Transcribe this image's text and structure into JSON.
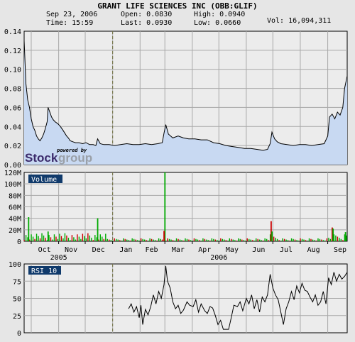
{
  "header": {
    "title": "GRANT LIFE SCIENCES INC (OBB:GLIF)",
    "date": "Sep 23, 2006",
    "time": "Time: 15:59",
    "open": "Open: 0.0830",
    "last": "Last: 0.0930",
    "high": "High: 0.0940",
    "low": "Low: 0.0660",
    "vol": "Vol: 16,094,311"
  },
  "logo": {
    "powered_by": "powered by",
    "brand_a": "Stock",
    "brand_b": "group"
  },
  "colors": {
    "background": "#e6e6e6",
    "price_fill": "#c8d9f2",
    "price_line": "#000000",
    "grid": "#a8a8a8",
    "vol_up": "#00aa00",
    "vol_down": "#cc0000",
    "panel_label_bg": "#103a6b",
    "panel_label_text": "#ffffff"
  },
  "chart_data": [
    {
      "type": "area",
      "title": "GRANT LIFE SCIENCES INC (OBB:GLIF)",
      "ylabel": "",
      "ylim": [
        0,
        0.14
      ],
      "yticks": [
        "0.14",
        "0.12",
        "0.10",
        "0.08",
        "0.06",
        "0.04",
        "0.02",
        "0.00"
      ],
      "grid": true,
      "x_start": "2005-09-23",
      "x_end": "2006-09-23",
      "price_points": [
        [
          "2005-09-23",
          0.13
        ],
        [
          "2005-09-25",
          0.085
        ],
        [
          "2005-09-27",
          0.068
        ],
        [
          "2005-09-29",
          0.06
        ],
        [
          "2005-10-01",
          0.048
        ],
        [
          "2005-10-03",
          0.04
        ],
        [
          "2005-10-05",
          0.036
        ],
        [
          "2005-10-07",
          0.03
        ],
        [
          "2005-10-09",
          0.027
        ],
        [
          "2005-10-11",
          0.025
        ],
        [
          "2005-10-13",
          0.028
        ],
        [
          "2005-10-15",
          0.032
        ],
        [
          "2005-10-17",
          0.038
        ],
        [
          "2005-10-19",
          0.045
        ],
        [
          "2005-10-20",
          0.06
        ],
        [
          "2005-10-22",
          0.055
        ],
        [
          "2005-10-24",
          0.05
        ],
        [
          "2005-10-26",
          0.047
        ],
        [
          "2005-10-28",
          0.045
        ],
        [
          "2005-10-31",
          0.043
        ],
        [
          "2005-11-03",
          0.04
        ],
        [
          "2005-11-06",
          0.036
        ],
        [
          "2005-11-08",
          0.033
        ],
        [
          "2005-11-10",
          0.03
        ],
        [
          "2005-11-12",
          0.028
        ],
        [
          "2005-11-14",
          0.025
        ],
        [
          "2005-11-17",
          0.024
        ],
        [
          "2005-11-20",
          0.023
        ],
        [
          "2005-11-24",
          0.023
        ],
        [
          "2005-11-28",
          0.022
        ],
        [
          "2005-12-02",
          0.023
        ],
        [
          "2005-12-06",
          0.021
        ],
        [
          "2005-12-10",
          0.021
        ],
        [
          "2005-12-13",
          0.02
        ],
        [
          "2005-12-15",
          0.027
        ],
        [
          "2005-12-18",
          0.022
        ],
        [
          "2005-12-22",
          0.021
        ],
        [
          "2005-12-28",
          0.021
        ],
        [
          "2006-01-03",
          0.02
        ],
        [
          "2006-01-10",
          0.021
        ],
        [
          "2006-01-17",
          0.022
        ],
        [
          "2006-01-24",
          0.021
        ],
        [
          "2006-01-31",
          0.021
        ],
        [
          "2006-02-07",
          0.022
        ],
        [
          "2006-02-14",
          0.021
        ],
        [
          "2006-02-21",
          0.022
        ],
        [
          "2006-02-26",
          0.023
        ],
        [
          "2006-02-28",
          0.033
        ],
        [
          "2006-03-02",
          0.042
        ],
        [
          "2006-03-05",
          0.032
        ],
        [
          "2006-03-10",
          0.028
        ],
        [
          "2006-03-16",
          0.03
        ],
        [
          "2006-03-22",
          0.028
        ],
        [
          "2006-03-28",
          0.027
        ],
        [
          "2006-04-04",
          0.027
        ],
        [
          "2006-04-11",
          0.026
        ],
        [
          "2006-04-18",
          0.026
        ],
        [
          "2006-04-25",
          0.023
        ],
        [
          "2006-05-02",
          0.022
        ],
        [
          "2006-05-09",
          0.02
        ],
        [
          "2006-05-16",
          0.019
        ],
        [
          "2006-05-23",
          0.018
        ],
        [
          "2006-05-30",
          0.017
        ],
        [
          "2006-06-06",
          0.017
        ],
        [
          "2006-06-13",
          0.016
        ],
        [
          "2006-06-20",
          0.015
        ],
        [
          "2006-06-25",
          0.016
        ],
        [
          "2006-06-28",
          0.022
        ],
        [
          "2006-06-30",
          0.034
        ],
        [
          "2006-07-03",
          0.027
        ],
        [
          "2006-07-06",
          0.024
        ],
        [
          "2006-07-10",
          0.022
        ],
        [
          "2006-07-17",
          0.021
        ],
        [
          "2006-07-24",
          0.02
        ],
        [
          "2006-07-31",
          0.021
        ],
        [
          "2006-08-07",
          0.021
        ],
        [
          "2006-08-14",
          0.02
        ],
        [
          "2006-08-21",
          0.021
        ],
        [
          "2006-08-28",
          0.022
        ],
        [
          "2006-09-01",
          0.03
        ],
        [
          "2006-09-03",
          0.05
        ],
        [
          "2006-09-06",
          0.053
        ],
        [
          "2006-09-09",
          0.048
        ],
        [
          "2006-09-12",
          0.055
        ],
        [
          "2006-09-15",
          0.052
        ],
        [
          "2006-09-18",
          0.06
        ],
        [
          "2006-09-20",
          0.08
        ],
        [
          "2006-09-23",
          0.093
        ]
      ]
    },
    {
      "type": "bar",
      "title": "Volume",
      "ylim": [
        0,
        120
      ],
      "yticks": [
        "120M",
        "100M",
        "80M",
        "60M",
        "40M",
        "20M",
        "0"
      ],
      "grid": true,
      "spikes": [
        [
          "2005-09-28",
          42,
          "up"
        ],
        [
          "2005-10-20",
          17,
          "up"
        ],
        [
          "2005-12-15",
          40,
          "up"
        ],
        [
          "2006-03-01",
          120,
          "up"
        ],
        [
          "2006-02-28",
          18,
          "down"
        ],
        [
          "2006-06-29",
          35,
          "down"
        ],
        [
          "2006-06-30",
          17,
          "up"
        ],
        [
          "2006-09-06",
          24,
          "down"
        ],
        [
          "2006-09-07",
          22,
          "up"
        ],
        [
          "2006-09-21",
          16,
          "up"
        ]
      ]
    },
    {
      "type": "line",
      "title": "RSI 10",
      "ylim": [
        0,
        100
      ],
      "yticks": [
        "100",
        "75",
        "50",
        "25",
        "0"
      ],
      "grid": true,
      "rsi_points": [
        [
          "2006-01-19",
          35
        ],
        [
          "2006-01-22",
          42
        ],
        [
          "2006-01-25",
          30
        ],
        [
          "2006-01-28",
          38
        ],
        [
          "2006-01-31",
          22
        ],
        [
          "2006-02-02",
          40
        ],
        [
          "2006-02-04",
          12
        ],
        [
          "2006-02-07",
          34
        ],
        [
          "2006-02-10",
          26
        ],
        [
          "2006-02-13",
          38
        ],
        [
          "2006-02-16",
          55
        ],
        [
          "2006-02-19",
          42
        ],
        [
          "2006-02-22",
          60
        ],
        [
          "2006-02-25",
          50
        ],
        [
          "2006-02-28",
          70
        ],
        [
          "2006-03-02",
          97
        ],
        [
          "2006-03-04",
          75
        ],
        [
          "2006-03-07",
          65
        ],
        [
          "2006-03-10",
          45
        ],
        [
          "2006-03-13",
          35
        ],
        [
          "2006-03-16",
          40
        ],
        [
          "2006-03-19",
          28
        ],
        [
          "2006-03-22",
          33
        ],
        [
          "2006-03-26",
          45
        ],
        [
          "2006-03-29",
          40
        ],
        [
          "2006-04-02",
          38
        ],
        [
          "2006-04-05",
          48
        ],
        [
          "2006-04-08",
          30
        ],
        [
          "2006-04-11",
          42
        ],
        [
          "2006-04-15",
          32
        ],
        [
          "2006-04-18",
          28
        ],
        [
          "2006-04-21",
          38
        ],
        [
          "2006-04-24",
          36
        ],
        [
          "2006-04-27",
          25
        ],
        [
          "2006-04-30",
          12
        ],
        [
          "2006-05-03",
          18
        ],
        [
          "2006-05-06",
          5
        ],
        [
          "2006-05-12",
          5
        ],
        [
          "2006-05-15",
          22
        ],
        [
          "2006-05-18",
          40
        ],
        [
          "2006-05-22",
          38
        ],
        [
          "2006-05-25",
          45
        ],
        [
          "2006-05-28",
          32
        ],
        [
          "2006-06-01",
          50
        ],
        [
          "2006-06-04",
          42
        ],
        [
          "2006-06-07",
          55
        ],
        [
          "2006-06-10",
          35
        ],
        [
          "2006-06-13",
          48
        ],
        [
          "2006-06-16",
          30
        ],
        [
          "2006-06-19",
          52
        ],
        [
          "2006-06-22",
          45
        ],
        [
          "2006-06-25",
          55
        ],
        [
          "2006-06-28",
          85
        ],
        [
          "2006-07-01",
          65
        ],
        [
          "2006-07-04",
          55
        ],
        [
          "2006-07-07",
          48
        ],
        [
          "2006-07-10",
          30
        ],
        [
          "2006-07-13",
          12
        ],
        [
          "2006-07-16",
          35
        ],
        [
          "2006-07-19",
          45
        ],
        [
          "2006-07-22",
          60
        ],
        [
          "2006-07-25",
          48
        ],
        [
          "2006-07-28",
          68
        ],
        [
          "2006-07-31",
          58
        ],
        [
          "2006-08-03",
          72
        ],
        [
          "2006-08-06",
          62
        ],
        [
          "2006-08-09",
          60
        ],
        [
          "2006-08-12",
          52
        ],
        [
          "2006-08-15",
          45
        ],
        [
          "2006-08-18",
          55
        ],
        [
          "2006-08-21",
          40
        ],
        [
          "2006-08-24",
          45
        ],
        [
          "2006-08-27",
          60
        ],
        [
          "2006-08-30",
          42
        ],
        [
          "2006-09-02",
          80
        ],
        [
          "2006-09-05",
          70
        ],
        [
          "2006-09-08",
          88
        ],
        [
          "2006-09-11",
          75
        ],
        [
          "2006-09-14",
          85
        ],
        [
          "2006-09-17",
          78
        ],
        [
          "2006-09-20",
          82
        ],
        [
          "2006-09-23",
          88
        ]
      ]
    }
  ],
  "x_axis": {
    "months": [
      {
        "label": "Oct",
        "date": "2005-10-16"
      },
      {
        "label": "Nov",
        "date": "2005-11-15"
      },
      {
        "label": "Dec",
        "date": "2005-12-16"
      },
      {
        "label": "Jan",
        "date": "2006-01-16"
      },
      {
        "label": "Feb",
        "date": "2006-02-14"
      },
      {
        "label": "Mar",
        "date": "2006-03-16"
      },
      {
        "label": "Apr",
        "date": "2006-04-15"
      },
      {
        "label": "May",
        "date": "2006-05-16"
      },
      {
        "label": "Jun",
        "date": "2006-06-15"
      },
      {
        "label": "Jul",
        "date": "2006-07-16"
      },
      {
        "label": "Aug",
        "date": "2006-08-16"
      },
      {
        "label": "Sep",
        "date": "2006-09-15"
      }
    ],
    "gridlines": [
      "2005-10-01",
      "2005-11-01",
      "2005-12-01",
      "2006-01-01",
      "2006-02-01",
      "2006-03-01",
      "2006-04-01",
      "2006-05-01",
      "2006-06-01",
      "2006-07-01",
      "2006-08-01",
      "2006-09-01"
    ],
    "years": [
      {
        "label": "2005",
        "date": "2005-11-01"
      },
      {
        "label": "2006",
        "date": "2006-05-01"
      }
    ],
    "year_divider": "2006-01-01"
  }
}
